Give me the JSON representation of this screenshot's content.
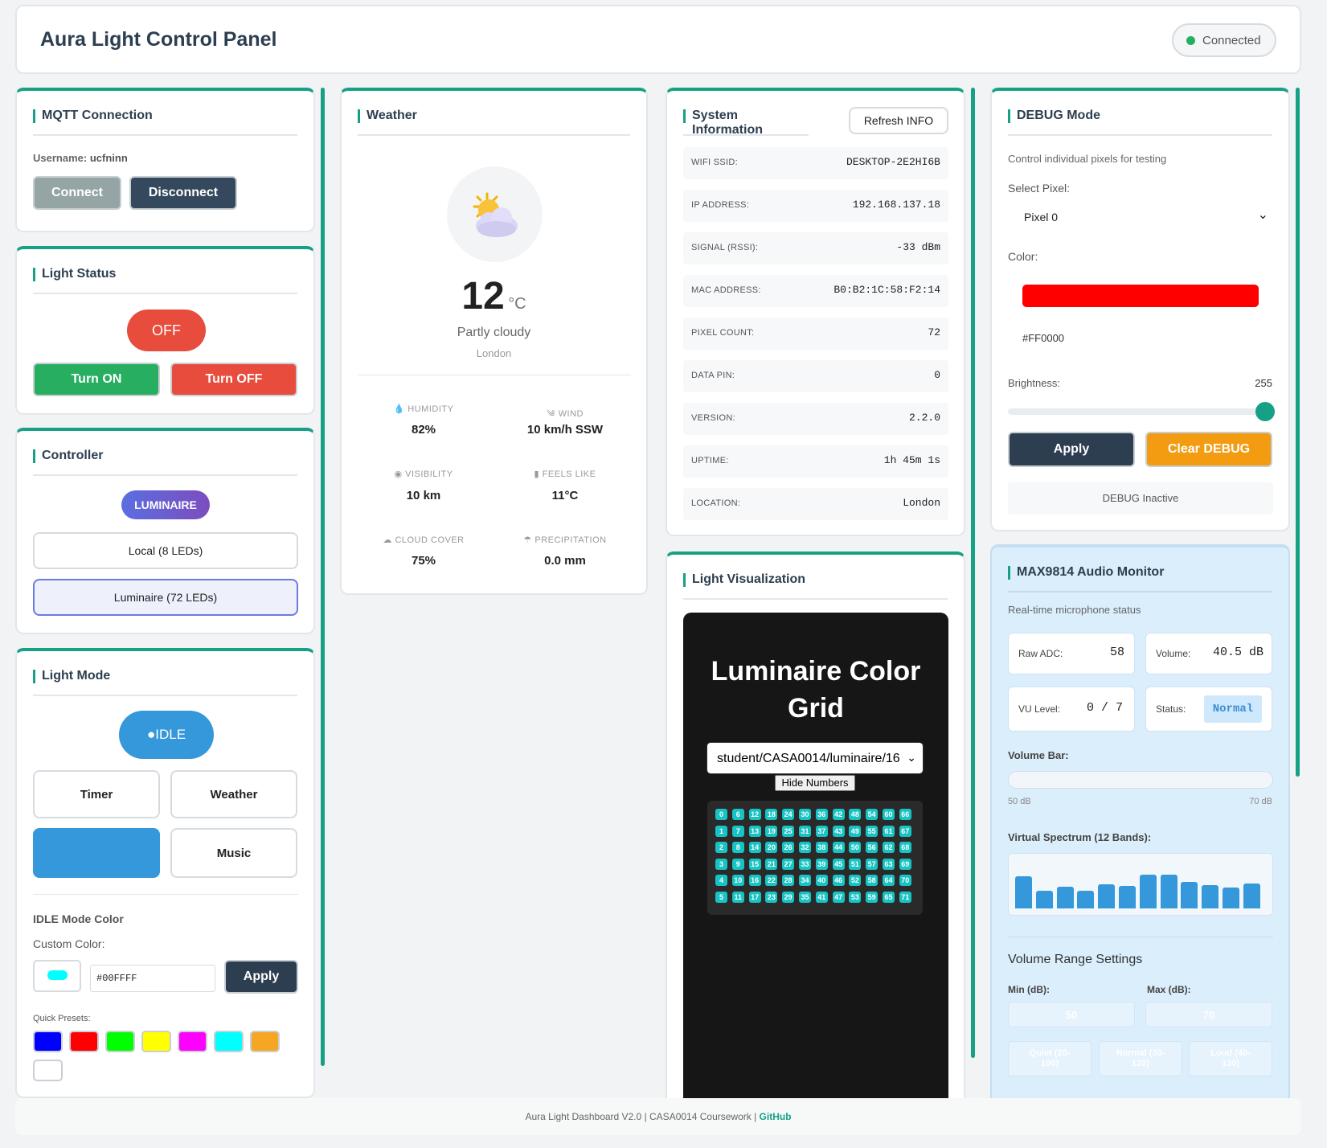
{
  "header": {
    "title": "Aura Light Control Panel",
    "status": "Connected"
  },
  "mqtt": {
    "title": "MQTT Connection",
    "username_label": "Username:",
    "username": "ucfninn",
    "connect": "Connect",
    "disconnect": "Disconnect"
  },
  "light_status": {
    "title": "Light Status",
    "state": "OFF",
    "turn_on": "Turn ON",
    "turn_off": "Turn OFF"
  },
  "controller": {
    "title": "Controller",
    "badge": "LUMINAIRE",
    "local": "Local (8 LEDs)",
    "luminaire": "Luminaire (72 LEDs)"
  },
  "light_mode": {
    "title": "Light Mode",
    "current": "●IDLE",
    "timer": "Timer",
    "weather": "Weather",
    "music": "Music",
    "color_title": "IDLE Mode Color",
    "custom_label": "Custom Color:",
    "hex": "#00FFFF",
    "apply": "Apply",
    "presets_label": "Quick Presets:",
    "presets": [
      "#0000ff",
      "#ff0000",
      "#00ff00",
      "#ffff00",
      "#ff00ff",
      "#00ffff",
      "#f5a623",
      "#ffffff"
    ]
  },
  "weather": {
    "title": "Weather",
    "temp": "12",
    "unit": "°C",
    "desc": "Partly cloudy",
    "city": "London",
    "humidity_label": "HUMIDITY",
    "humidity": "82%",
    "wind_label": "WIND",
    "wind": "10 km/h SSW",
    "visibility_label": "VISIBILITY",
    "visibility": "10 km",
    "feels_label": "FEELS LIKE",
    "feels": "11°C",
    "cloud_label": "CLOUD COVER",
    "cloud": "75%",
    "precip_label": "PRECIPITATION",
    "precip": "0.0 mm"
  },
  "sysinfo": {
    "title": "System Information",
    "refresh": "Refresh INFO",
    "rows": [
      {
        "k": "WIFI SSID:",
        "v": "DESKTOP-2E2HI6B"
      },
      {
        "k": "IP ADDRESS:",
        "v": "192.168.137.18"
      },
      {
        "k": "SIGNAL (RSSI):",
        "v": "-33 dBm"
      },
      {
        "k": "MAC ADDRESS:",
        "v": "B0:B2:1C:58:F2:14"
      },
      {
        "k": "PIXEL COUNT:",
        "v": "72"
      },
      {
        "k": "DATA PIN:",
        "v": "0"
      },
      {
        "k": "VERSION:",
        "v": "2.2.0"
      },
      {
        "k": "UPTIME:",
        "v": "1h 45m 1s"
      },
      {
        "k": "LOCATION:",
        "v": "London"
      }
    ]
  },
  "viz": {
    "title": "Light Visualization",
    "grid_title": "Luminaire Color Grid",
    "topic": "student/CASA0014/luminaire/16",
    "hide": "Hide Numbers",
    "led_count": 72
  },
  "debug": {
    "title": "DEBUG Mode",
    "desc": "Control individual pixels for testing",
    "select_label": "Select Pixel:",
    "pixel": "Pixel 0",
    "color_label": "Color:",
    "color": "#FF0000",
    "brightness_label": "Brightness:",
    "brightness": "255",
    "apply": "Apply",
    "clear": "Clear DEBUG",
    "status": "DEBUG Inactive"
  },
  "audio": {
    "title": "MAX9814 Audio Monitor",
    "desc": "Real-time microphone status",
    "raw_label": "Raw ADC:",
    "raw": "58",
    "vol_label": "Volume:",
    "vol": "40.5 dB",
    "vu_label": "VU Level:",
    "vu": "0 / 7",
    "status_label": "Status:",
    "status": "Normal",
    "bar_label": "Volume Bar:",
    "bar_min": "50 dB",
    "bar_max": "70 dB",
    "spectrum_label": "Virtual Spectrum (12 Bands):",
    "spectrum": [
      40,
      22,
      27,
      22,
      30,
      28,
      42,
      42,
      33,
      29,
      26,
      31
    ],
    "range_title": "Volume Range Settings",
    "min_label": "Min (dB):",
    "max_label": "Max (dB):",
    "min": "50",
    "max": "70",
    "quiet": "Quiet (20-100)",
    "normal": "Normal (30-120)",
    "loud": "Loud (40-130)"
  },
  "footer": {
    "text": "Aura Light Dashboard V2.0 | CASA0014 Coursework | ",
    "link": "GitHub"
  }
}
